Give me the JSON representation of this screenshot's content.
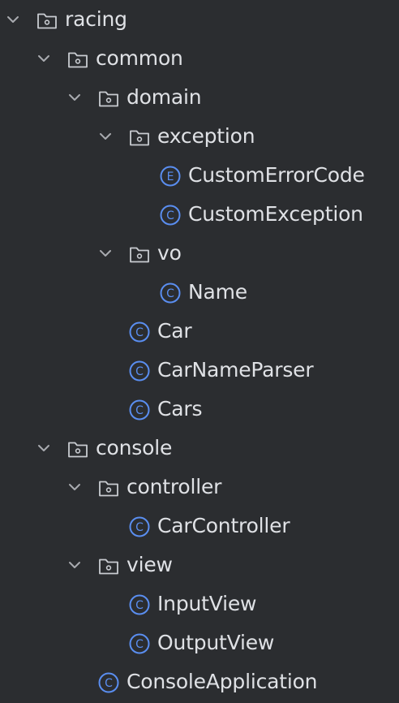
{
  "project_tree": {
    "items": [
      {
        "kind": "folder",
        "label": "racing",
        "expanded": true,
        "depth": 0
      },
      {
        "kind": "folder",
        "label": "common",
        "expanded": true,
        "depth": 1
      },
      {
        "kind": "folder",
        "label": "domain",
        "expanded": true,
        "depth": 2
      },
      {
        "kind": "folder",
        "label": "exception",
        "expanded": true,
        "depth": 3
      },
      {
        "kind": "enum",
        "badge": "E",
        "label": "CustomErrorCode",
        "depth": 4
      },
      {
        "kind": "class",
        "badge": "C",
        "label": "CustomException",
        "depth": 4
      },
      {
        "kind": "folder",
        "label": "vo",
        "expanded": true,
        "depth": 3
      },
      {
        "kind": "class",
        "badge": "C",
        "label": "Name",
        "depth": 4
      },
      {
        "kind": "class",
        "badge": "C",
        "label": "Car",
        "depth": 3
      },
      {
        "kind": "class",
        "badge": "C",
        "label": "CarNameParser",
        "depth": 3
      },
      {
        "kind": "class",
        "badge": "C",
        "label": "Cars",
        "depth": 3
      },
      {
        "kind": "folder",
        "label": "console",
        "expanded": true,
        "depth": 1
      },
      {
        "kind": "folder",
        "label": "controller",
        "expanded": true,
        "depth": 2
      },
      {
        "kind": "class",
        "badge": "C",
        "label": "CarController",
        "depth": 3
      },
      {
        "kind": "folder",
        "label": "view",
        "expanded": true,
        "depth": 2
      },
      {
        "kind": "class",
        "badge": "C",
        "label": "InputView",
        "depth": 3
      },
      {
        "kind": "class",
        "badge": "C",
        "label": "OutputView",
        "depth": 3
      },
      {
        "kind": "class",
        "badge": "C",
        "label": "ConsoleApplication",
        "depth": 2
      }
    ]
  },
  "colors": {
    "background": "#2b2d30",
    "text": "#dfe1e5",
    "chevron": "#a9abb0",
    "folder_outline": "#c9ccd1",
    "badge_blue": "#5a8ef0"
  },
  "icons": {
    "chevron": "chevron-down-icon",
    "folder": "package-folder-icon",
    "class": "class-icon",
    "enum": "enum-icon"
  }
}
